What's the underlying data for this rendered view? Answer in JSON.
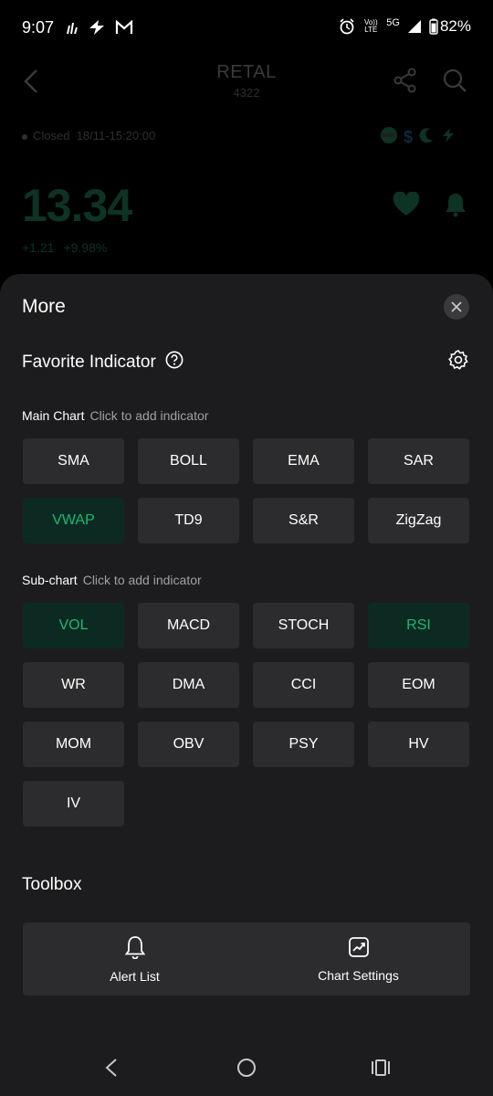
{
  "status_bar": {
    "time": "9:07",
    "network": "5G",
    "volte": "Vo)) LTE",
    "battery": "82%"
  },
  "background": {
    "title": "RETAL",
    "code": "4322",
    "status": "Closed",
    "timestamp": "18/11-15:20:00",
    "price": "13.34",
    "change": "+1.21",
    "change_pct": "+9.98%"
  },
  "sheet": {
    "title": "More",
    "favorite_title": "Favorite Indicator",
    "main_chart": {
      "label": "Main Chart",
      "hint": "Click to add indicator",
      "items": [
        {
          "label": "SMA",
          "active": false
        },
        {
          "label": "BOLL",
          "active": false
        },
        {
          "label": "EMA",
          "active": false
        },
        {
          "label": "SAR",
          "active": false
        },
        {
          "label": "VWAP",
          "active": true
        },
        {
          "label": "TD9",
          "active": false
        },
        {
          "label": "S&R",
          "active": false
        },
        {
          "label": "ZigZag",
          "active": false
        }
      ]
    },
    "sub_chart": {
      "label": "Sub-chart",
      "hint": "Click to add indicator",
      "items": [
        {
          "label": "VOL",
          "active": true
        },
        {
          "label": "MACD",
          "active": false
        },
        {
          "label": "STOCH",
          "active": false
        },
        {
          "label": "RSI",
          "active": true
        },
        {
          "label": "WR",
          "active": false
        },
        {
          "label": "DMA",
          "active": false
        },
        {
          "label": "CCI",
          "active": false
        },
        {
          "label": "EOM",
          "active": false
        },
        {
          "label": "MOM",
          "active": false
        },
        {
          "label": "OBV",
          "active": false
        },
        {
          "label": "PSY",
          "active": false
        },
        {
          "label": "HV",
          "active": false
        },
        {
          "label": "IV",
          "active": false
        }
      ]
    },
    "toolbox": {
      "title": "Toolbox",
      "alert_list": "Alert List",
      "chart_settings": "Chart Settings"
    }
  },
  "colors": {
    "sheet_bg": "#1c1c1e",
    "chip_bg": "#2c2c2e",
    "active_bg": "#0d2a22",
    "active_text": "#19b971"
  }
}
